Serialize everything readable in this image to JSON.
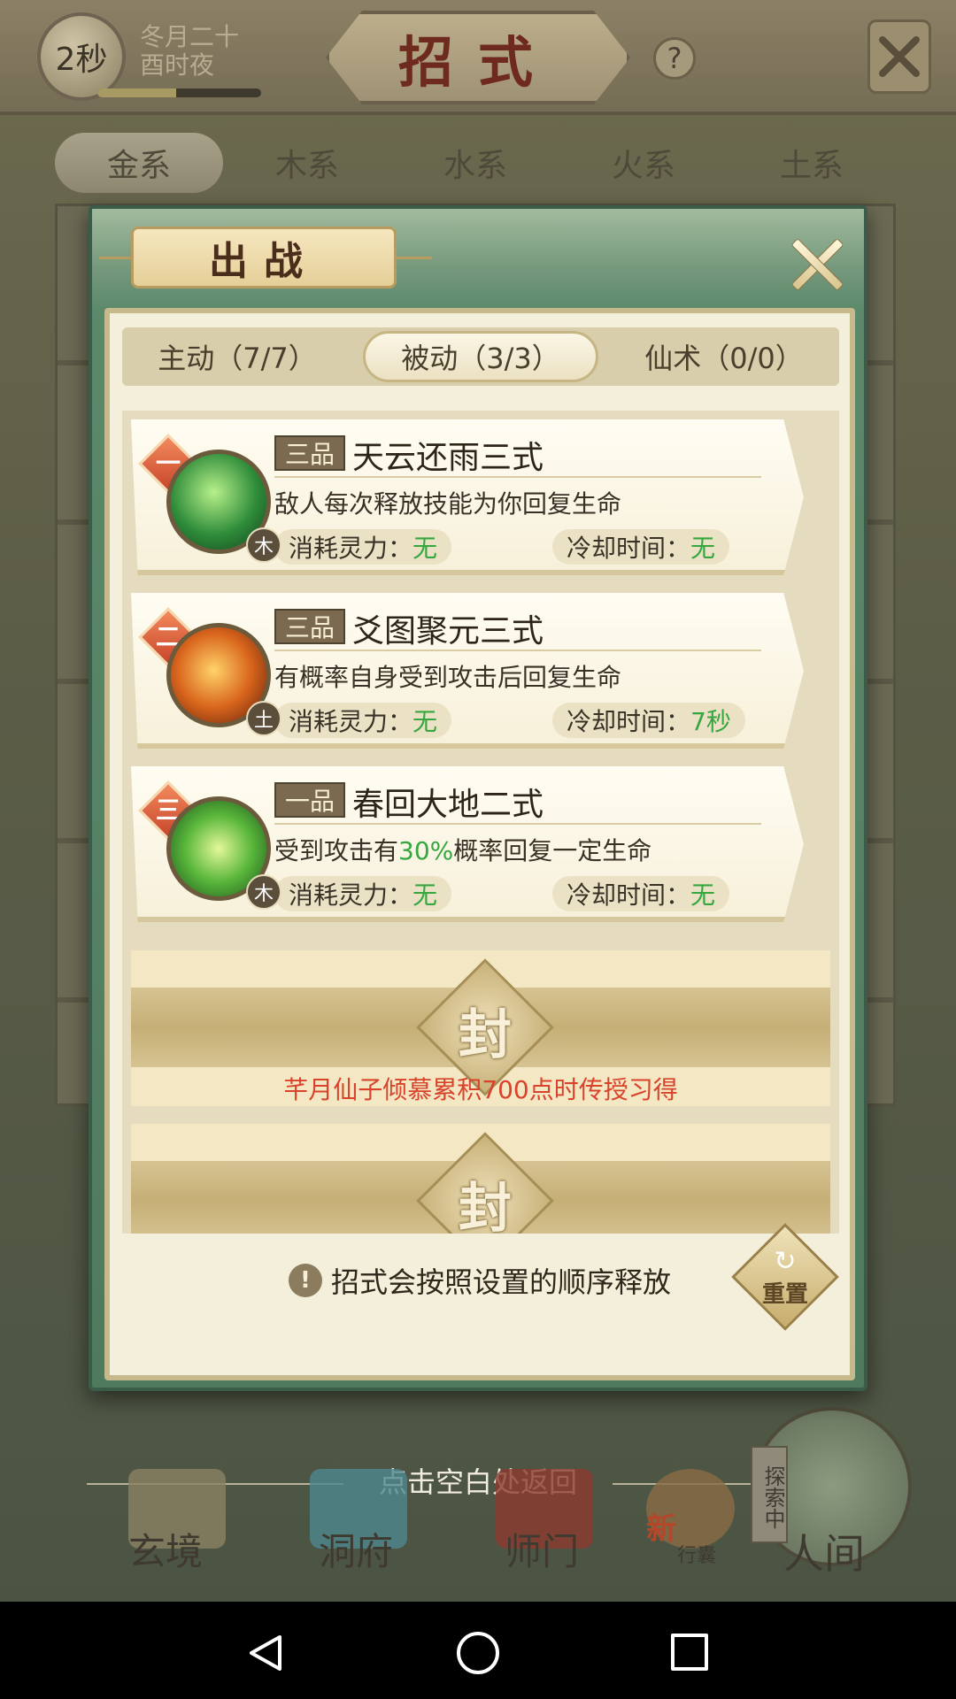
{
  "header": {
    "timer": "2秒",
    "date_line1": "冬月二十",
    "date_line2": "酉时夜",
    "time_progress": 0.48,
    "title": "招式",
    "help": "?"
  },
  "element_tabs": [
    "金系",
    "木系",
    "水系",
    "火系",
    "土系"
  ],
  "modal": {
    "title": "出战",
    "sub_tabs": [
      "主动（7/7）",
      "被动（3/3）",
      "仙术（0/0）"
    ],
    "active_sub_tab": 1,
    "cost_label": "消耗灵力：",
    "cooldown_label": "冷却时间：",
    "skills": [
      {
        "rank": "一",
        "grade": "三品",
        "name": "天云还雨三式",
        "desc": "敌人每次释放技能为你回复生命",
        "element": "木",
        "cost": "无",
        "cooldown": "无",
        "icon": "green-scroll-icon"
      },
      {
        "rank": "二",
        "grade": "三品",
        "name": "爻图聚元三式",
        "desc": "有概率自身受到攻击后回复生命",
        "element": "土",
        "cost": "无",
        "cooldown": "7秒",
        "icon": "golden-cauldron-icon"
      },
      {
        "rank": "三",
        "grade": "一品",
        "name": "春回大地二式",
        "desc_pre": "受到攻击有",
        "desc_hl": "30%",
        "desc_post": "概率回复一定生命",
        "element": "木",
        "cost": "无",
        "cooldown": "无",
        "icon": "green-swirl-icon"
      }
    ],
    "sealed_char": "封",
    "sealed_text": "芊月仙子倾慕累积700点时传授习得",
    "sealed_char_2": "封",
    "order_note": "招式会按照设置的顺序释放",
    "reset_label": "重置"
  },
  "bottom": {
    "tap_hint": "点击空白处返回",
    "nav": [
      "玄境",
      "洞府",
      "师门",
      "行囊",
      "人间"
    ],
    "bag_new": "新",
    "explore_tag": "探索中"
  },
  "colors": {
    "accent_green": "#36a63e",
    "sealed_red": "#d9432b",
    "modal_green": "#5e8a6c",
    "title_red": "#6f2a1f"
  }
}
